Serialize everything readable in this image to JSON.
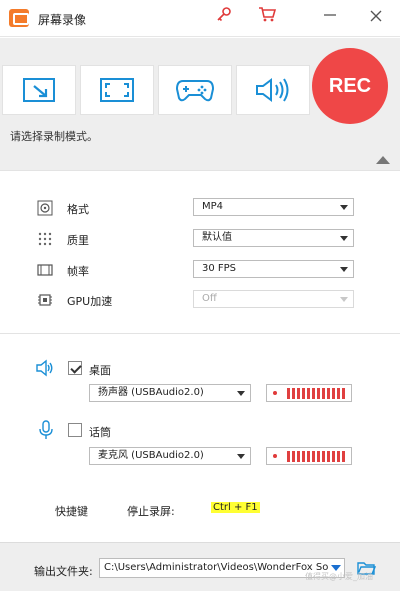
{
  "titlebar": {
    "title": "屏幕录像",
    "icons": [
      "app-logo-icon",
      "key-icon",
      "cart-icon",
      "minimize-icon",
      "close-icon"
    ]
  },
  "toolbar": {
    "modes": [
      {
        "name": "region-mode",
        "icon": "region-select-icon"
      },
      {
        "name": "fullscreen-mode",
        "icon": "fullscreen-icon"
      },
      {
        "name": "game-mode",
        "icon": "gamepad-icon"
      },
      {
        "name": "audio-only-mode",
        "icon": "speaker-icon"
      }
    ],
    "rec_label": "REC",
    "hint": "请选择录制模式。"
  },
  "settings": {
    "format": {
      "label": "格式",
      "value": "MP4"
    },
    "quality": {
      "label": "质里",
      "value": "默认值"
    },
    "framerate": {
      "label": "帧率",
      "value": "30 FPS"
    },
    "gpu": {
      "label": "GPU加速",
      "value": "Off"
    }
  },
  "audio": {
    "desktop": {
      "label": "桌面",
      "checked": true,
      "device": "扬声器 (USBAudio2.0)"
    },
    "mic": {
      "label": "话筒",
      "checked": false,
      "device": "麦克风 (USBAudio2.0)"
    }
  },
  "hotkey": {
    "title": "快捷键",
    "action": "停止录屏:",
    "value": "Ctrl + F1"
  },
  "output": {
    "label": "输出文件夹:",
    "path": "C:\\Users\\Administrator\\Videos\\WonderFox Soft\\HD Vide",
    "watermark": "值得买@小爱_加油"
  },
  "colors": {
    "accent_red": "#ef4747",
    "hotkey_highlight": "#ffff33",
    "icon_blue": "#1a8fd6"
  }
}
